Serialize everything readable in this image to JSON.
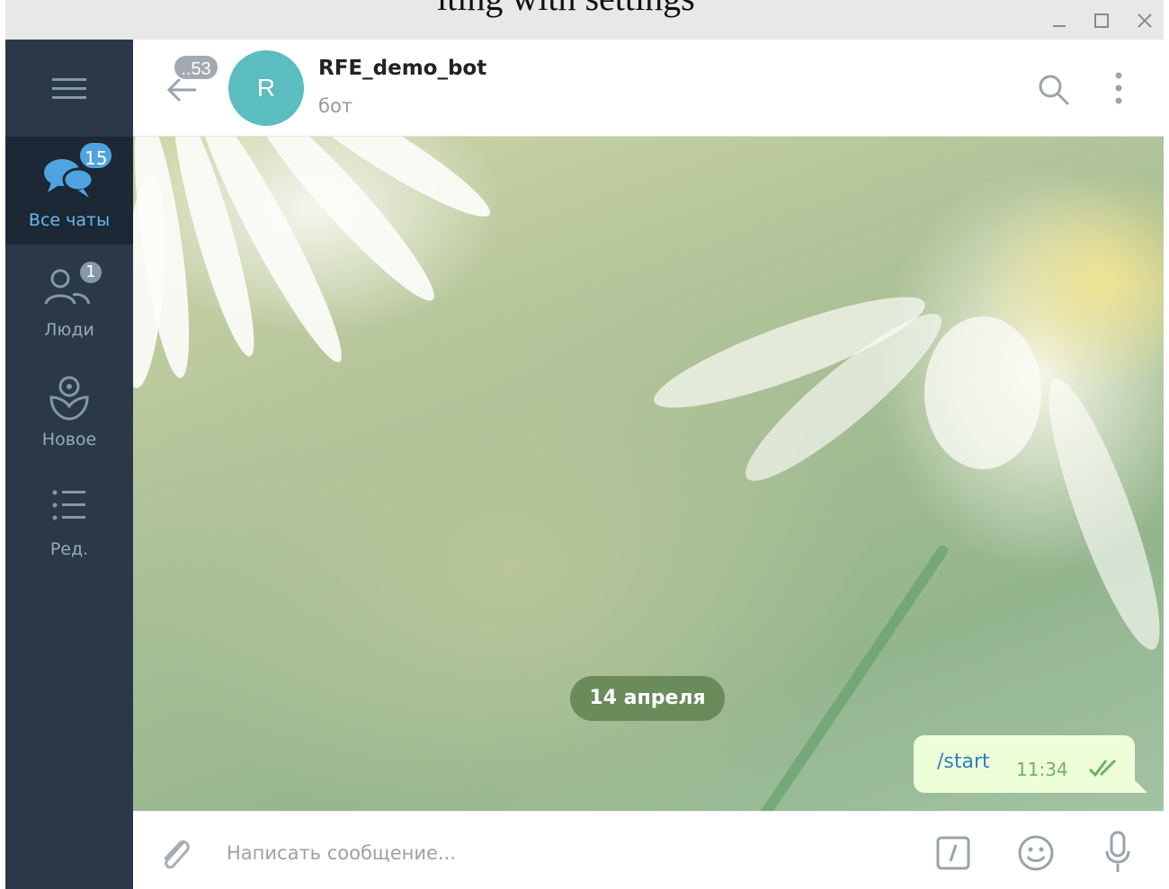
{
  "window": {
    "top_caption": "iting with settings"
  },
  "sidebar": {
    "folders": [
      {
        "label": "Все чаты",
        "badge": "15",
        "icon": "chats-icon",
        "active": true
      },
      {
        "label": "Люди",
        "badge": "1",
        "icon": "people-icon",
        "active": false
      },
      {
        "label": "Новое",
        "badge": "",
        "icon": "flower-icon",
        "active": false
      },
      {
        "label": "Ред.",
        "badge": "",
        "icon": "list-edit-icon",
        "active": false
      }
    ]
  },
  "header": {
    "back_badge": "..53",
    "avatar_letter": "R",
    "name": "RFE_demo_bot",
    "status": "бот"
  },
  "chat": {
    "date_label": "14 апреля",
    "messages": [
      {
        "text": "/start",
        "time": "11:34",
        "outgoing": true,
        "read": true
      }
    ]
  },
  "composer": {
    "placeholder": "Написать сообщение..."
  },
  "colors": {
    "sidebar": "#2a384a",
    "sidebar_active": "#1c2836",
    "accent": "#4fa3e0",
    "avatar": "#5bbdbf",
    "bubble_out": "#eefed9"
  }
}
